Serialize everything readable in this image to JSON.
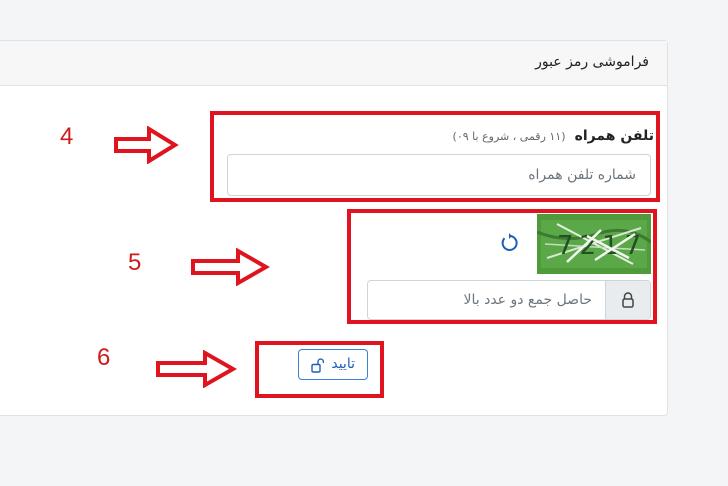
{
  "card": {
    "title": "فراموشی رمز عبور"
  },
  "phone": {
    "label": "تلفن همراه",
    "hint": "(۱۱ رقمی ، شروع با ۰۹)",
    "placeholder": "شماره تلفن همراه"
  },
  "captcha": {
    "text": "7217"
  },
  "sum": {
    "placeholder": "حاصل جمع دو عدد بالا"
  },
  "submit": {
    "label": "تایید"
  },
  "annotations": [
    "4",
    "5",
    "6"
  ],
  "colors": {
    "annotation_red": "#e0141e",
    "primary_blue": "#3d7fd6"
  },
  "icons": {
    "refresh": "refresh-icon",
    "lock": "lock-icon",
    "unlock": "unlock-icon",
    "arrow": "right-arrow-outline-icon"
  }
}
